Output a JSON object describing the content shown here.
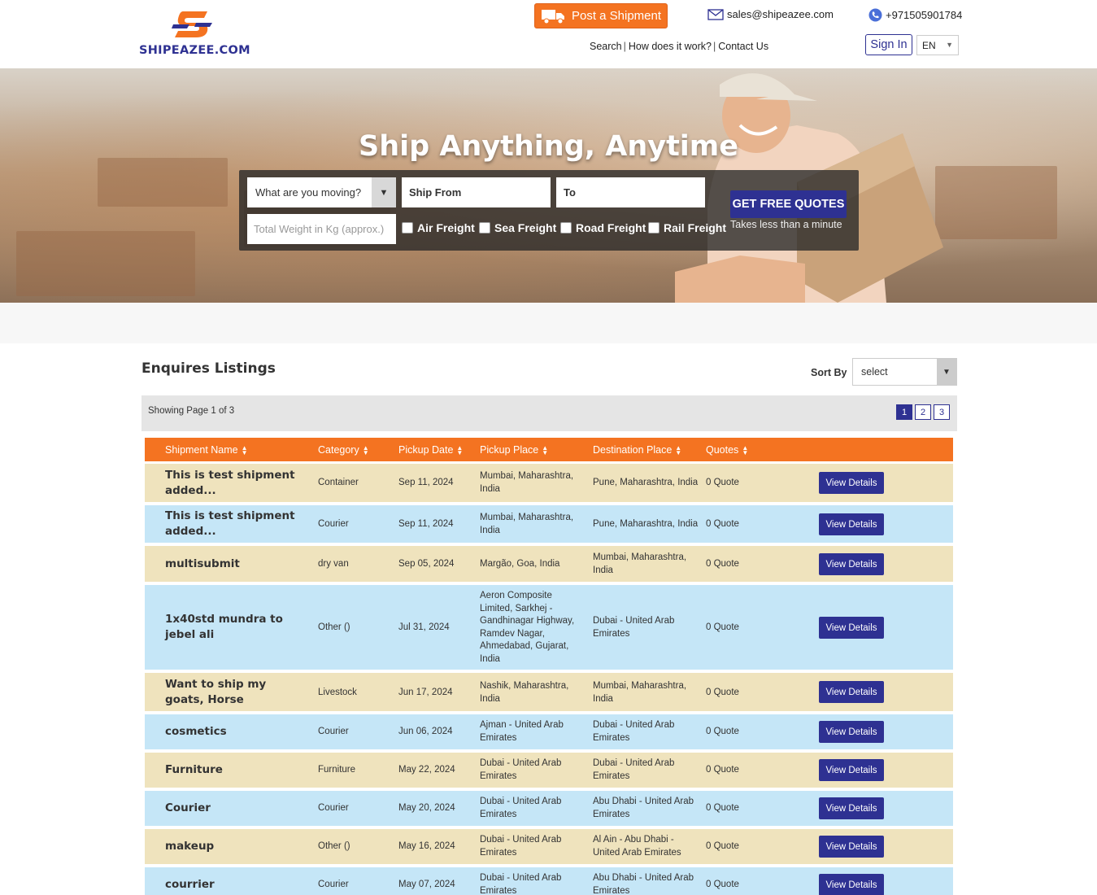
{
  "header": {
    "logo_text": "SHIPEAZEE.COM",
    "post_button": "Post a Shipment",
    "email": "sales@shipeazee.com",
    "phone": "+971505901784",
    "nav": [
      "Search",
      "How does it work?",
      "Contact Us"
    ],
    "signin": "Sign In",
    "language": "EN"
  },
  "hero": {
    "title": "Ship Anything, Anytime",
    "moving_placeholder": "What are you moving?",
    "ship_from_placeholder": "Ship From",
    "to_placeholder": "To",
    "weight_placeholder": "Total Weight in Kg (approx.)",
    "freight_options": [
      "Air Freight",
      "Sea Freight",
      "Road Freight",
      "Rail Freight"
    ],
    "quote_button": "GET FREE QUOTES",
    "quote_subtext": "Takes less than a minute"
  },
  "listing": {
    "title": "Enquires Listings",
    "sort_label": "Sort By",
    "sort_value": "select",
    "page_info": "Showing Page 1 of 3",
    "pages": [
      "1",
      "2",
      "3"
    ],
    "columns": [
      "Shipment Name",
      "Category",
      "Pickup Date",
      "Pickup Place",
      "Destination Place",
      "Quotes"
    ],
    "view_label": "View Details",
    "rows": [
      {
        "name": "This is test shipment added...",
        "category": "Container",
        "date": "Sep 11, 2024",
        "pickup": "Mumbai, Maharashtra, India",
        "destination": "Pune, Maharashtra, India",
        "quotes": "0 Quote"
      },
      {
        "name": "This is test shipment added...",
        "category": "Courier",
        "date": "Sep 11, 2024",
        "pickup": "Mumbai, Maharashtra, India",
        "destination": "Pune, Maharashtra, India",
        "quotes": "0 Quote"
      },
      {
        "name": "multisubmit",
        "category": "dry van",
        "date": "Sep 05, 2024",
        "pickup": "Margão, Goa, India",
        "destination": "Mumbai, Maharashtra, India",
        "quotes": "0 Quote"
      },
      {
        "name": "1x40std mundra to jebel ali",
        "category": "Other ()",
        "date": "Jul 31, 2024",
        "pickup": "Aeron Composite Limited, Sarkhej - Gandhinagar Highway, Ramdev Nagar, Ahmedabad, Gujarat, India",
        "destination": "Dubai - United Arab Emirates",
        "quotes": "0 Quote"
      },
      {
        "name": "Want to ship my goats, Horse",
        "category": "Livestock",
        "date": "Jun 17, 2024",
        "pickup": "Nashik, Maharashtra, India",
        "destination": "Mumbai, Maharashtra, India",
        "quotes": "0 Quote"
      },
      {
        "name": "cosmetics",
        "category": "Courier",
        "date": "Jun 06, 2024",
        "pickup": "Ajman - United Arab Emirates",
        "destination": "Dubai - United Arab Emirates",
        "quotes": "0 Quote"
      },
      {
        "name": "Furniture",
        "category": "Furniture",
        "date": "May 22, 2024",
        "pickup": "Dubai - United Arab Emirates",
        "destination": "Dubai - United Arab Emirates",
        "quotes": "0 Quote"
      },
      {
        "name": "Courier",
        "category": "Courier",
        "date": "May 20, 2024",
        "pickup": "Dubai - United Arab Emirates",
        "destination": "Abu Dhabi - United Arab Emirates",
        "quotes": "0 Quote"
      },
      {
        "name": "makeup",
        "category": "Other ()",
        "date": "May 16, 2024",
        "pickup": "Dubai - United Arab Emirates",
        "destination": "Al Ain - Abu Dhabi - United Arab Emirates",
        "quotes": "0 Quote"
      },
      {
        "name": "courrier",
        "category": "Courier",
        "date": "May 07, 2024",
        "pickup": "Dubai - United Arab Emirates",
        "destination": "Abu Dhabi - United Arab Emirates",
        "quotes": "0 Quote"
      }
    ]
  },
  "colors": {
    "brand_orange": "#f47321",
    "brand_navy": "#2e3192",
    "row_tan": "#efe3bd",
    "row_blue": "#c5e6f7"
  }
}
